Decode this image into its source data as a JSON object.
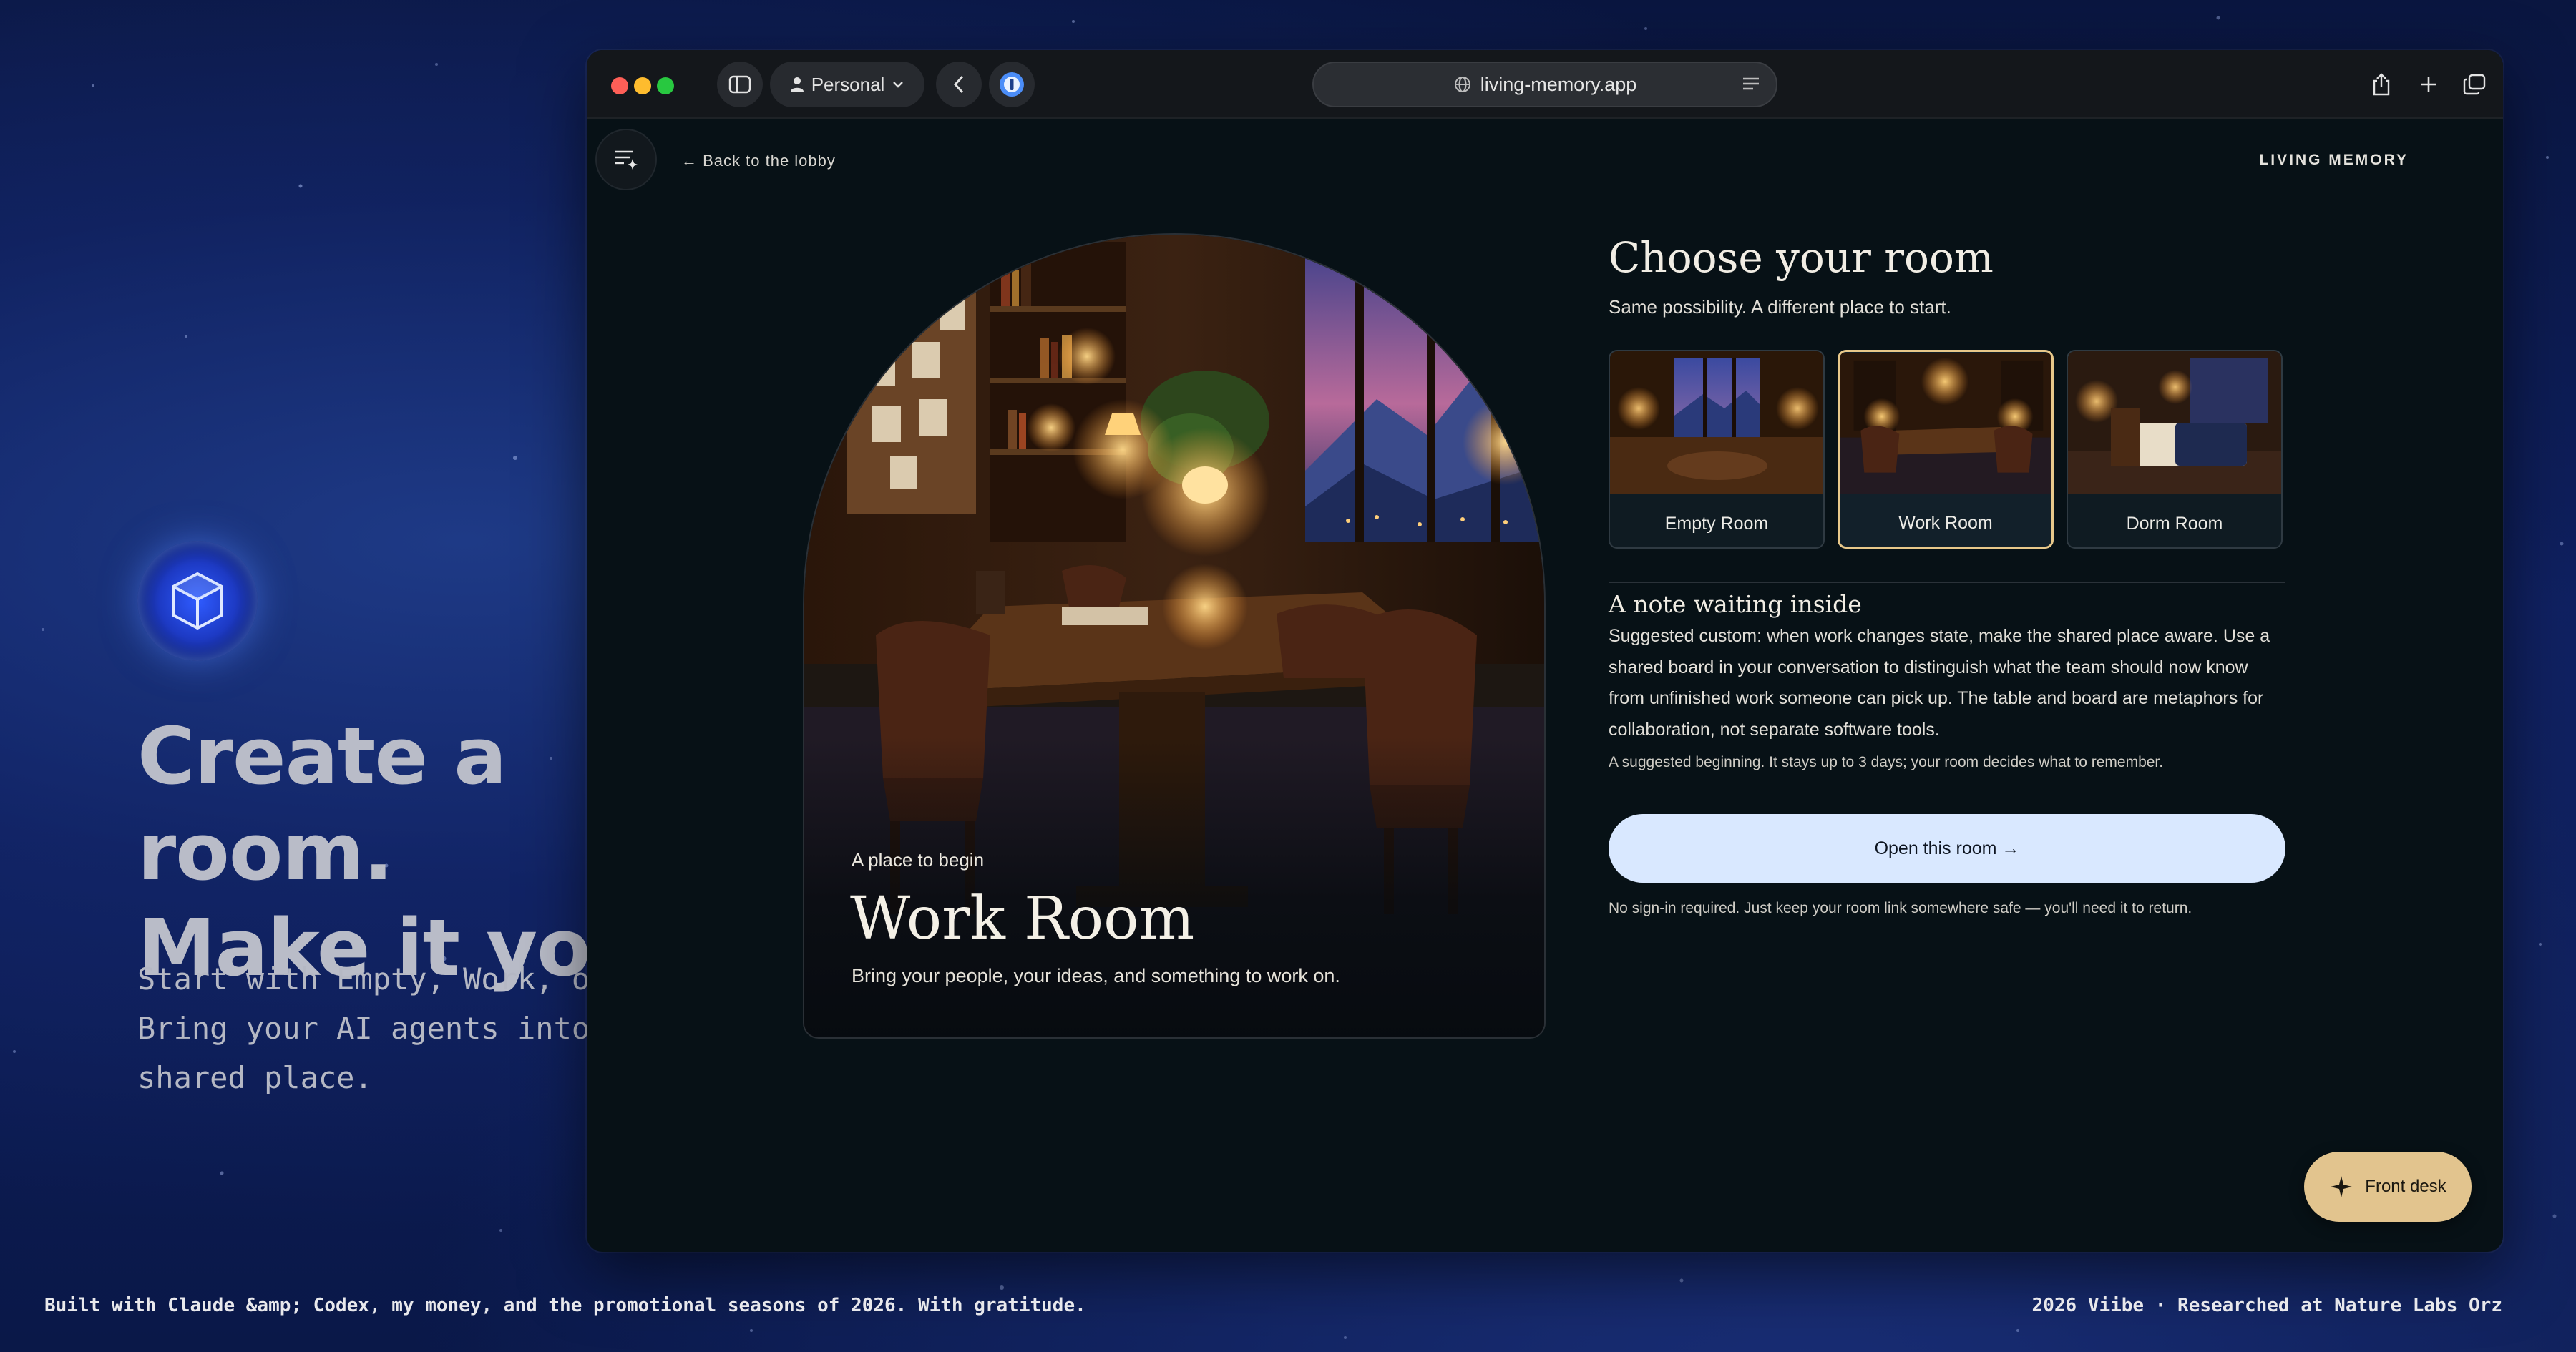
{
  "hero": {
    "title_line1": "Create a room.",
    "title_line2": "Make it yours.",
    "subtitle": "Start with Empty, Work, or Dorm.\nBring your AI agents into one\nshared place."
  },
  "footer": {
    "left": "Built with Claude &amp; Codex, my money, and the promotional seasons of 2026. With gratitude.",
    "right": "2026 Viibe · Researched at Nature Labs Orz"
  },
  "browser": {
    "profile_label": "Personal",
    "url": "living-memory.app",
    "icons": [
      "sidebar-toggle-icon",
      "person-icon",
      "chevron-down-icon",
      "back-icon",
      "password-manager-icon",
      "globe-icon",
      "reader-icon",
      "share-icon",
      "plus-icon",
      "tabs-icon"
    ]
  },
  "page": {
    "back_link": "← Back to the lobby",
    "brand": "LIVING MEMORY",
    "card": {
      "kicker": "A place to begin",
      "title": "Work Room",
      "description": "Bring your people, your ideas, and something to work on."
    },
    "panel": {
      "title": "Choose your room",
      "subtitle": "Same possibility. A different place to start.",
      "rooms": [
        {
          "label": "Empty Room",
          "selected": false
        },
        {
          "label": "Work Room",
          "selected": true
        },
        {
          "label": "Dorm Room",
          "selected": false
        }
      ],
      "note_title": "A note waiting inside",
      "note_body": "Suggested custom: when work changes state, make the shared place aware. Use a shared board in your conversation to distinguish what the team should now know from unfinished work someone can pick up. The table and board are metaphors for collaboration, not separate software tools.",
      "note_hint": "A suggested beginning. It stays up to 3 days; your room decides what to remember.",
      "open_button": "Open this room →",
      "disclaimer": "No sign-in required. Just keep your room link somewhere safe — you'll need it to return."
    },
    "front_desk": "Front desk"
  },
  "colors": {
    "accent_gold": "#e2c48e",
    "button_blue": "#d9e8ff",
    "window_bg": "#071116"
  }
}
